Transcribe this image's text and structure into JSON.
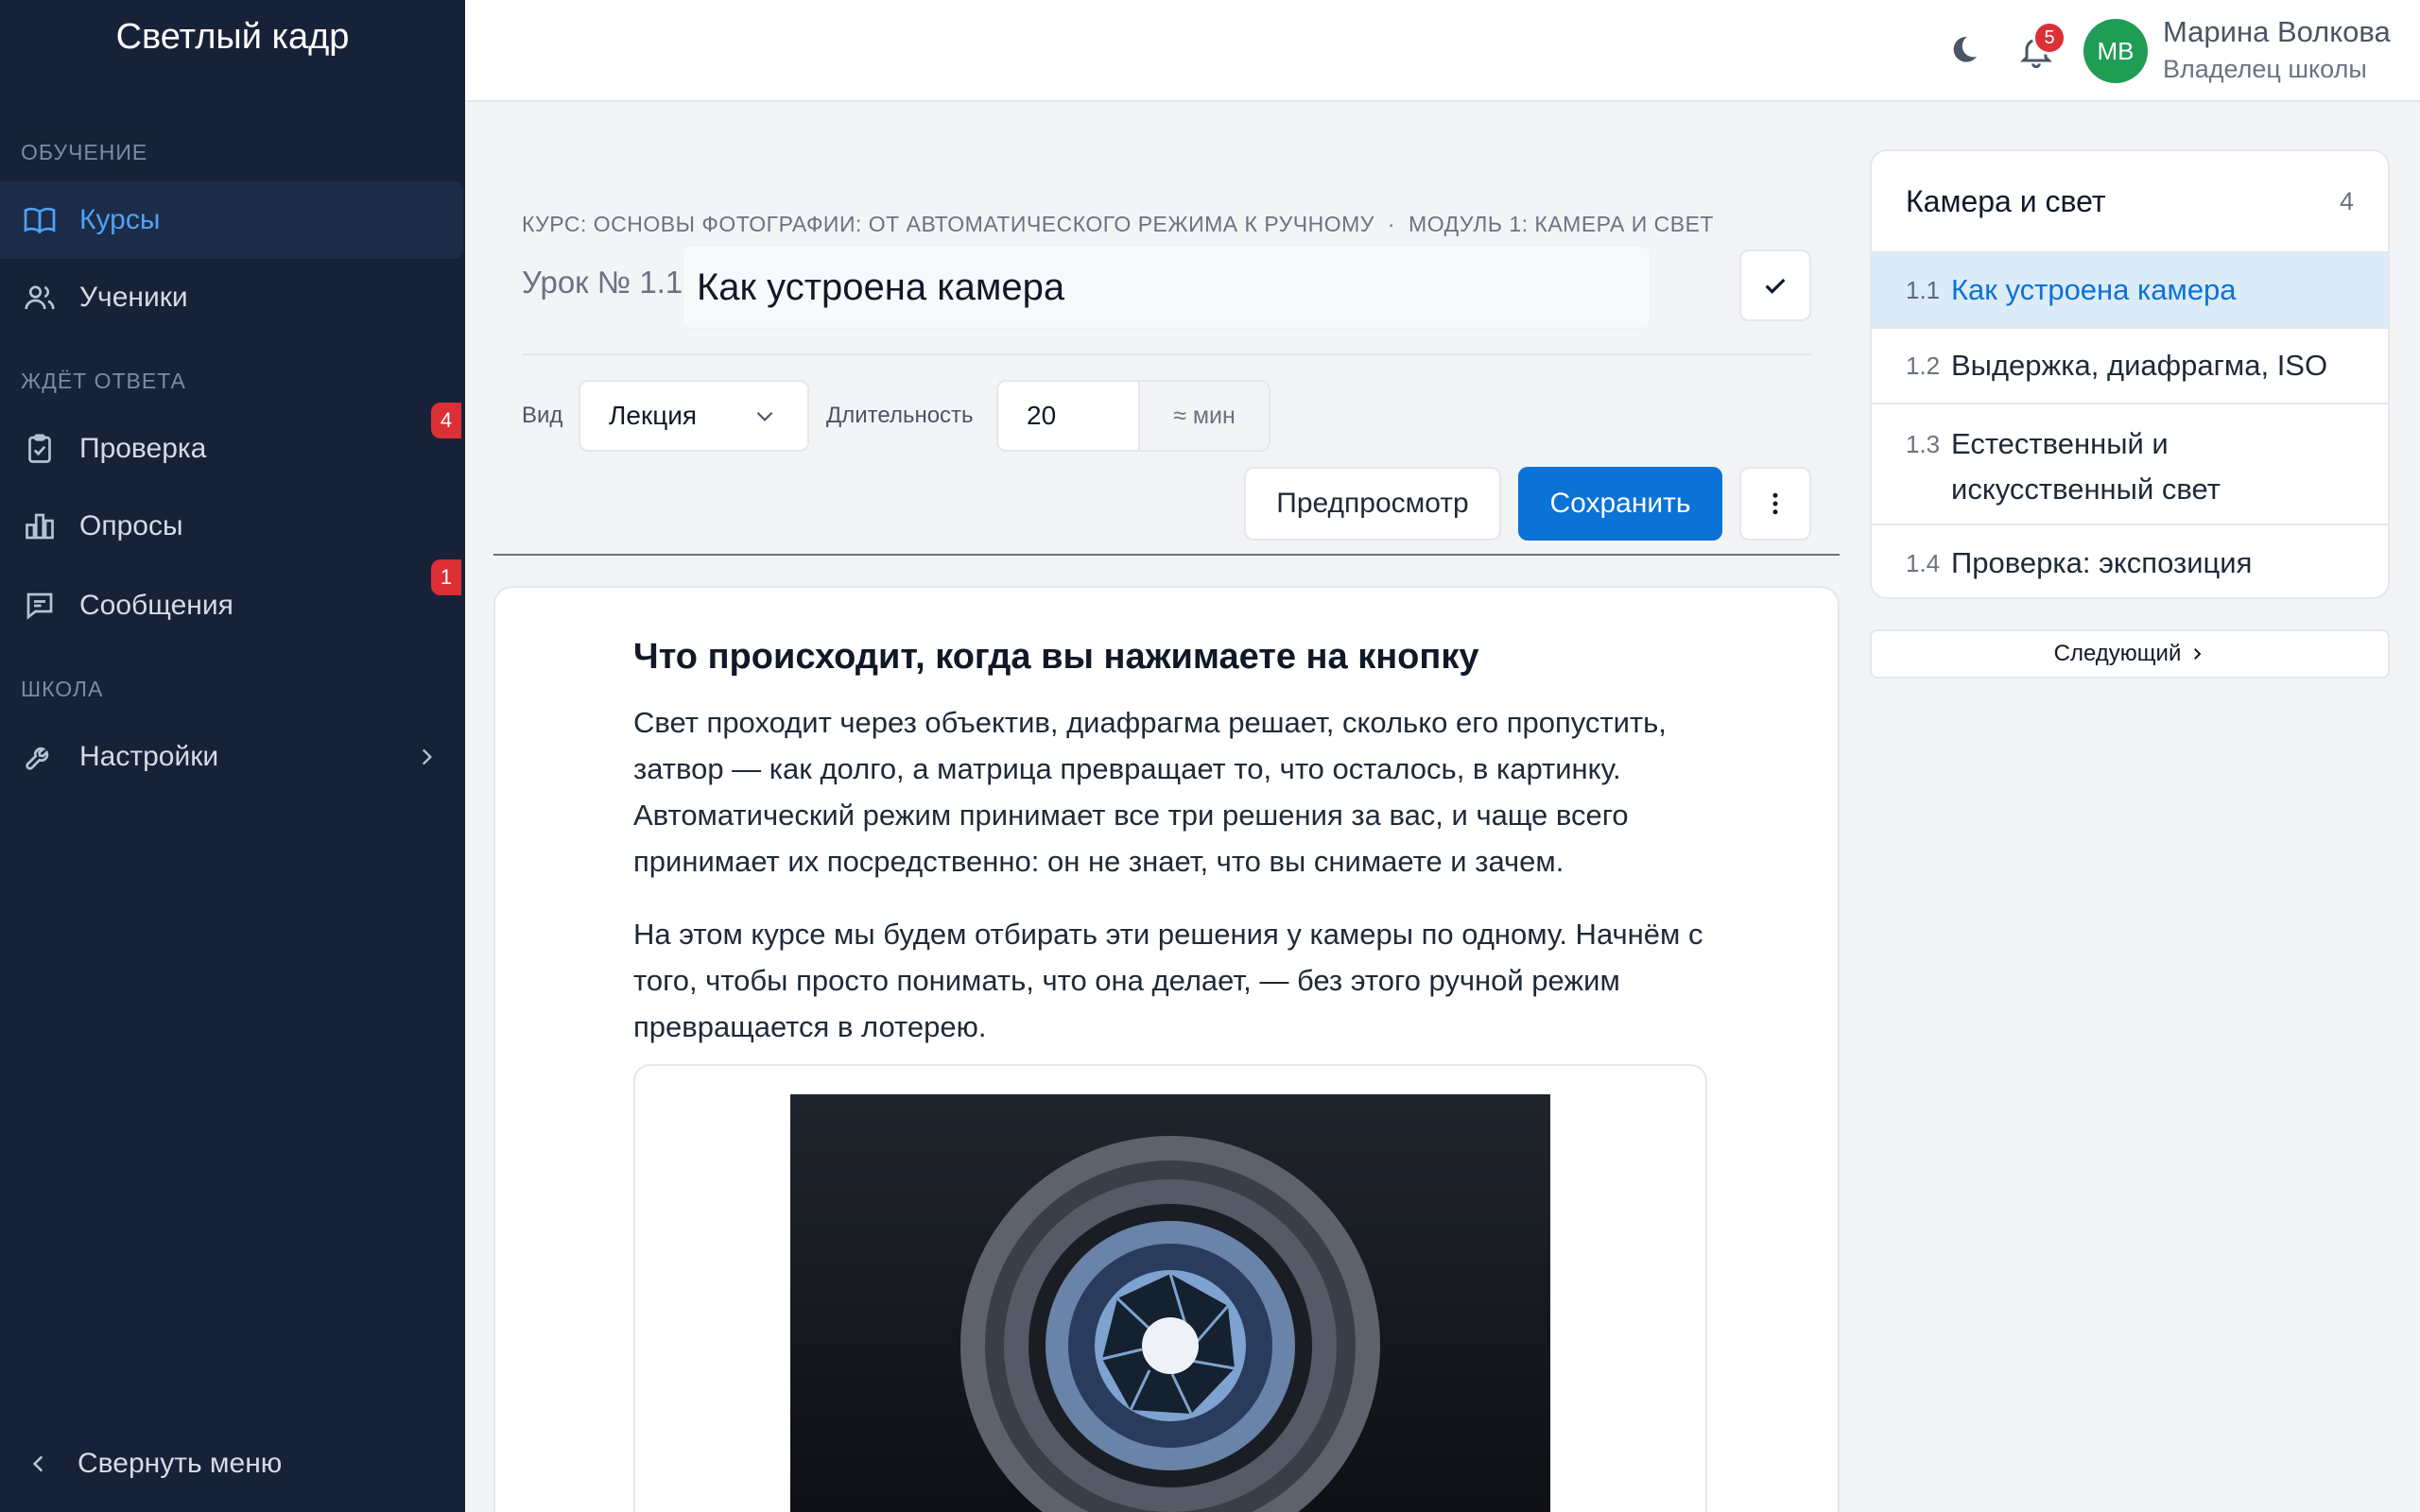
{
  "sidebar": {
    "brand": "Светлый кадр",
    "sections": [
      "Обучение",
      "Ждёт ответа",
      "Школа"
    ],
    "items": [
      {
        "label": "Курсы",
        "icon": "book-icon",
        "active": true
      },
      {
        "label": "Ученики",
        "icon": "users-icon"
      },
      {
        "label": "Проверка",
        "icon": "clipboard-check-icon",
        "badge": "4"
      },
      {
        "label": "Опросы",
        "icon": "bar-chart-icon"
      },
      {
        "label": "Сообщения",
        "icon": "message-icon",
        "badge": "1"
      },
      {
        "label": "Настройки",
        "icon": "wrench-icon"
      }
    ],
    "collapse_label": "Свернуть меню"
  },
  "topbar": {
    "notifications": "5",
    "avatar_initials": "МВ",
    "user_name": "Марина Волкова",
    "user_role": "Владелец школы"
  },
  "editor": {
    "breadcrumb_course": "Курс: Основы фотографии: от автоматического режима к ручному",
    "breadcrumb_sep": "·",
    "breadcrumb_module": "Модуль 1: Камера и свет",
    "lesson_number": "Урок № 1.1",
    "title": "Как устроена камера",
    "type_label": "Вид",
    "type_value": "Лекция",
    "duration_label": "Длительность",
    "duration_value": "20",
    "duration_unit": "≈ мин",
    "preview_label": "Предпросмотр",
    "save_label": "Сохранить"
  },
  "content": {
    "heading": "Что происходит, когда вы нажимаете на кнопку",
    "paragraph1": "Свет проходит через объектив, диафрагма решает, сколько его пропустить, затвор — как долго, а матрица превращает то, что осталось, в картинку. Автоматический режим принимает все три решения за вас, и чаще всего принимает их посредственно: он не знает, что вы снимаете и зачем.",
    "paragraph2": "На этом курсе мы будем отбирать эти решения у камеры по одному. Начнём с того, чтобы просто понимать, что она делает, — без этого ручной режим превращается в лотерею."
  },
  "module": {
    "title": "Камера и свет",
    "count": "4",
    "lessons": [
      {
        "num": "1.1",
        "title": "Как устроена камера",
        "active": true
      },
      {
        "num": "1.2",
        "title": "Выдержка, диафрагма, ISO"
      },
      {
        "num": "1.3",
        "title": "Естественный и искусственный свет"
      },
      {
        "num": "1.4",
        "title": "Проверка: экспозиция"
      }
    ],
    "next_label": "Следующий"
  },
  "colors": {
    "sidebar_bg": "#172238",
    "accent": "#0b72d6",
    "badge": "#dc2f36",
    "avatar": "#1f9d55"
  }
}
